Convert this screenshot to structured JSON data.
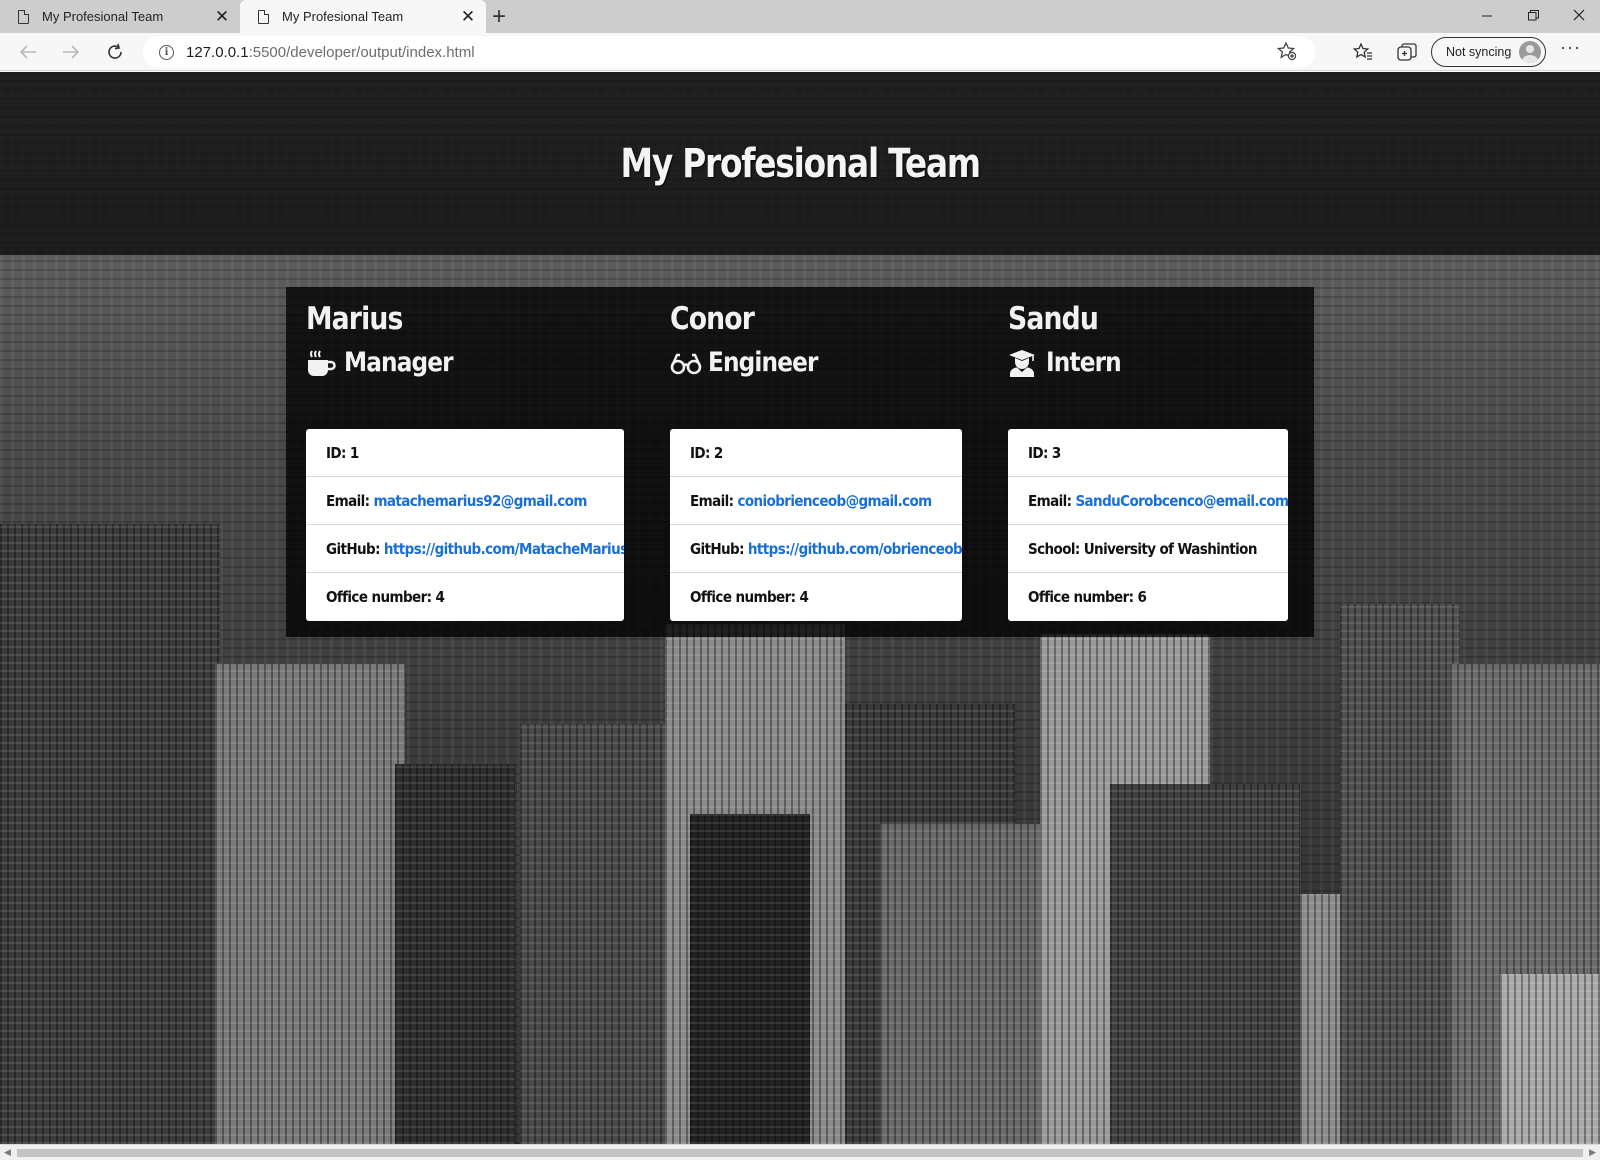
{
  "browser": {
    "tabs": [
      {
        "title": "My Profesional Team",
        "active": false
      },
      {
        "title": "My Profesional Team",
        "active": true
      }
    ],
    "url_host": "127.0.0.1",
    "url_rest": ":5500/developer/output/index.html",
    "sync_label": "Not syncing"
  },
  "page": {
    "title": "My Profesional Team",
    "members": [
      {
        "name": "Marius",
        "role": "Manager",
        "role_icon": "coffee-icon",
        "rows": [
          {
            "key": "ID:",
            "value": "1",
            "link": false
          },
          {
            "key": "Email:",
            "value": "matachemarius92@gmail.com",
            "link": true
          },
          {
            "key": "GitHub:",
            "value": "https://github.com/MatacheMarius",
            "link": true
          },
          {
            "key": "Office number:",
            "value": "4",
            "link": false
          }
        ]
      },
      {
        "name": "Conor",
        "role": "Engineer",
        "role_icon": "glasses-icon",
        "rows": [
          {
            "key": "ID:",
            "value": "2",
            "link": false
          },
          {
            "key": "Email:",
            "value": "coniobrienceob@gmail.com",
            "link": true
          },
          {
            "key": "GitHub:",
            "value": "https://github.com/obrienceob",
            "link": true
          },
          {
            "key": "Office number:",
            "value": "4",
            "link": false
          }
        ]
      },
      {
        "name": "Sandu",
        "role": "Intern",
        "role_icon": "graduate-icon",
        "rows": [
          {
            "key": "ID:",
            "value": "3",
            "link": false
          },
          {
            "key": "Email:",
            "value": "SanduCorobcenco@email.com",
            "link": true
          },
          {
            "key": "School:",
            "value": "University of Washintion",
            "link": false
          },
          {
            "key": "Office number:",
            "value": "6",
            "link": false
          }
        ]
      }
    ]
  },
  "colors": {
    "link": "#1a6fd6",
    "hero_bg": "#0f0f0f",
    "card_bg": "#ffffff"
  }
}
